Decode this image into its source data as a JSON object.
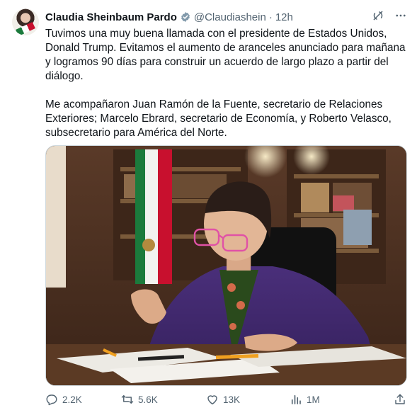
{
  "author": {
    "name": "Claudia Sheinbaum Pardo",
    "handle": "@Claudiashein",
    "separator": "·",
    "time": "12h"
  },
  "tweet": {
    "paragraph1": "Tuvimos una muy buena llamada con el presidente de Estados Unidos, Donald Trump. Evitamos el aumento de aranceles anunciado para mañana y logramos 90 días para construir un acuerdo de largo plazo a partir del diálogo.",
    "paragraph2": "Me acompañaron Juan Ramón de la Fuente, secretario de Relaciones Exteriores; Marcelo Ebrard, secretario de Economía, y Roberto Velasco, subsecretario para América del Norte."
  },
  "stats": {
    "replies": "2.2K",
    "reposts": "5.6K",
    "likes": "13K",
    "views": "1M"
  },
  "icons": {
    "verified": "verified-badge-icon",
    "grok": "grok-icon",
    "more": "more-icon",
    "reply": "reply-icon",
    "repost": "repost-icon",
    "like": "like-icon",
    "views": "views-icon",
    "share": "share-icon"
  },
  "colors": {
    "text": "#0f1419",
    "secondary": "#536471",
    "verified": "#829aab",
    "border": "#cfd9de"
  }
}
